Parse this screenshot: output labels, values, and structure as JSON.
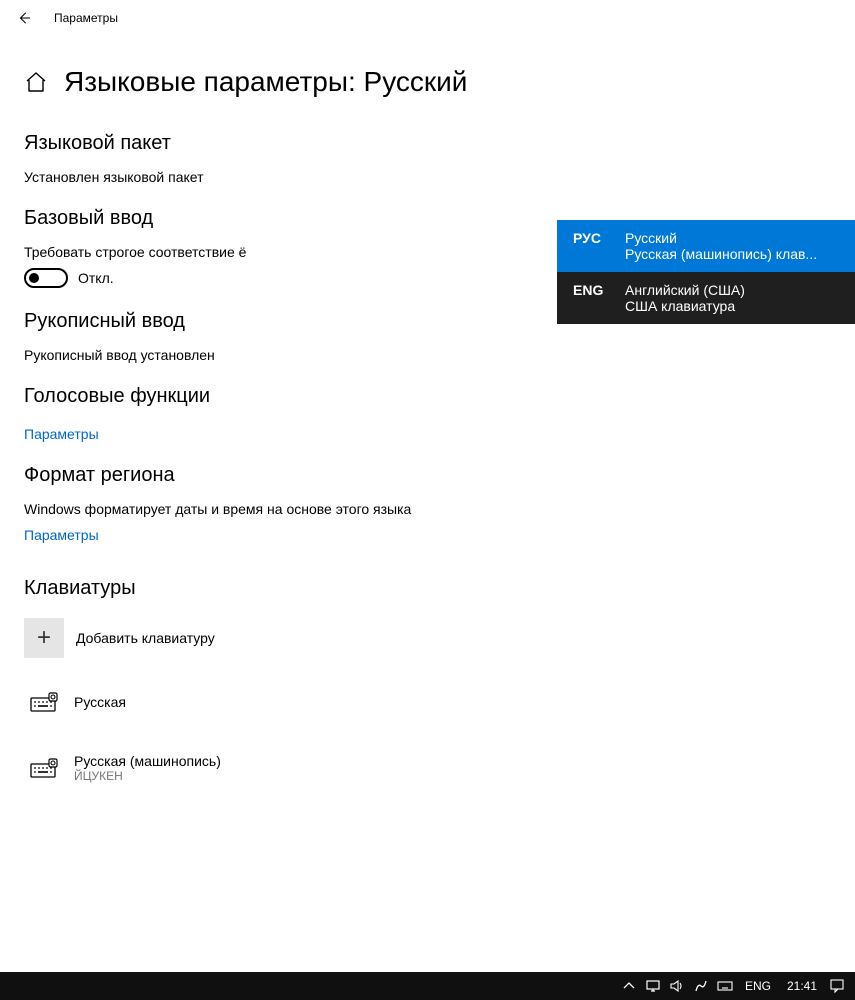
{
  "window": {
    "app_title": "Параметры"
  },
  "page": {
    "title": "Языковые параметры: Русский"
  },
  "sections": {
    "lang_pack": {
      "heading": "Языковой пакет",
      "status": "Установлен языковой пакет"
    },
    "basic_input": {
      "heading": "Базовый ввод",
      "option_label": "Требовать строгое соответствие ё",
      "toggle_state": "Откл."
    },
    "handwriting": {
      "heading": "Рукописный ввод",
      "status": "Рукописный ввод установлен"
    },
    "speech": {
      "heading": "Голосовые функции",
      "link": "Параметры"
    },
    "region": {
      "heading": "Формат региона",
      "status": "Windows форматирует даты и время на основе этого языка",
      "link": "Параметры"
    },
    "keyboards": {
      "heading": "Клавиатуры",
      "add_label": "Добавить клавиатуру",
      "items": [
        {
          "name": "Русская",
          "sub": ""
        },
        {
          "name": "Русская (машинопись)",
          "sub": "ЙЦУКЕН"
        }
      ]
    }
  },
  "lang_switcher": {
    "items": [
      {
        "code": "РУС",
        "line1": "Русский",
        "line2": "Русская (машинопись) клав...",
        "selected": true
      },
      {
        "code": "ENG",
        "line1": "Английский (США)",
        "line2": "США клавиатура",
        "selected": false
      }
    ]
  },
  "taskbar": {
    "lang": "ENG",
    "time": "21:41"
  }
}
